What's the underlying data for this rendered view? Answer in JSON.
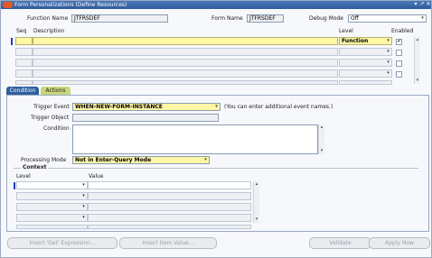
{
  "window": {
    "title": "Form Personalizations (Define Resources)",
    "controls": [
      "▾",
      "↗",
      "✕"
    ]
  },
  "header": {
    "function_name_label": "Function Name",
    "function_name_value": "JTFRSDEF",
    "form_name_label": "Form Name",
    "form_name_value": "JTFRSDEF",
    "debug_mode_label": "Debug Mode",
    "debug_mode_value": "Off"
  },
  "rules_table": {
    "columns": {
      "seq": "Seq",
      "description": "Description",
      "level": "Level",
      "enabled": "Enabled"
    },
    "rows": [
      {
        "seq": "",
        "description": "",
        "level": "Function",
        "enabled": "✔"
      },
      {
        "seq": "",
        "description": "",
        "level": "",
        "enabled": ""
      },
      {
        "seq": "",
        "description": "",
        "level": "",
        "enabled": ""
      },
      {
        "seq": "",
        "description": "",
        "level": "",
        "enabled": ""
      },
      {
        "seq": "",
        "description": "",
        "level": "",
        "enabled": ""
      }
    ]
  },
  "tabs": [
    {
      "label": "Condition",
      "active": true
    },
    {
      "label": "Actions",
      "active": false
    }
  ],
  "condition": {
    "trigger_event_label": "Trigger Event",
    "trigger_event_value": "WHEN-NEW-FORM-INSTANCE",
    "trigger_event_hint": "(You can enter additional event names.)",
    "trigger_object_label": "Trigger Object",
    "trigger_object_value": "",
    "condition_label": "Condition",
    "condition_value": "",
    "processing_mode_label": "Processing Mode",
    "processing_mode_value": "Not in Enter-Query Mode"
  },
  "context": {
    "section_label": "Context",
    "columns": {
      "level": "Level",
      "value": "Value"
    },
    "rows": [
      {
        "level": "",
        "value": ""
      },
      {
        "level": "",
        "value": ""
      },
      {
        "level": "",
        "value": ""
      },
      {
        "level": "",
        "value": ""
      },
      {
        "level": "",
        "value": ""
      }
    ]
  },
  "buttons": {
    "insert_get_expression": "Insert 'Get' Expression...",
    "insert_item_value": "Insert Item Value...",
    "validate": "Validate",
    "apply_now": "Apply Now"
  },
  "colors": {
    "title_bar": "#2e5a9c",
    "required_field": "#fdf7a6",
    "current_record_marker": "#1e3cc8",
    "active_tab": "#2f5e9e",
    "inactive_tab": "#c9d67c"
  }
}
